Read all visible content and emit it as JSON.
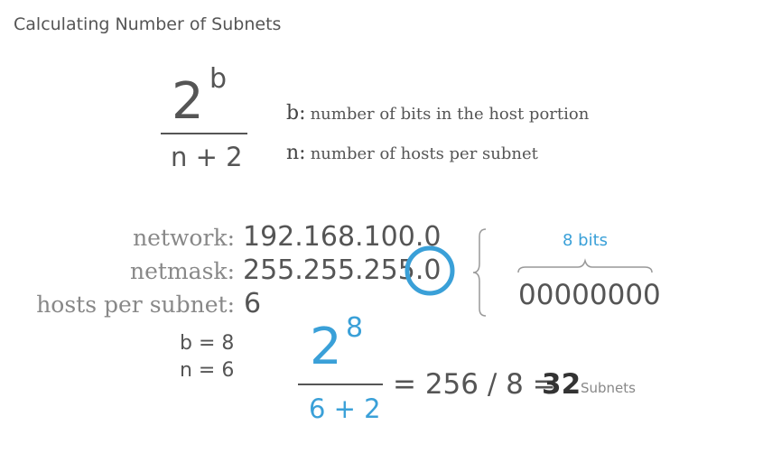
{
  "title": "Calculating Number of Subnets",
  "formula": {
    "base": "2",
    "exponent": "b",
    "denominator": "n + 2"
  },
  "legend": [
    {
      "key": "b:",
      "desc": "number of bits in the host portion"
    },
    {
      "key": "n:",
      "desc": "number of hosts per subnet"
    }
  ],
  "network": {
    "network_label": "network:",
    "network_value": "192.168.100.0",
    "netmask_label": "netmask:",
    "netmask_prefix": "255.255.255.",
    "netmask_last": "0",
    "hosts_label": "hosts per subnet:",
    "hosts_value": "6"
  },
  "bits": {
    "label": "8 bits",
    "binary": "00000000"
  },
  "vars": {
    "b": "b = 8",
    "n": "n = 6"
  },
  "calc": {
    "base": "2",
    "exponent": "8",
    "denominator": "6 + 2",
    "equation": "= 256 / 8 =",
    "result": "32",
    "unit": "Subnets"
  },
  "colors": {
    "accent": "#3aa0d8",
    "text": "#555555",
    "label": "#888888"
  }
}
